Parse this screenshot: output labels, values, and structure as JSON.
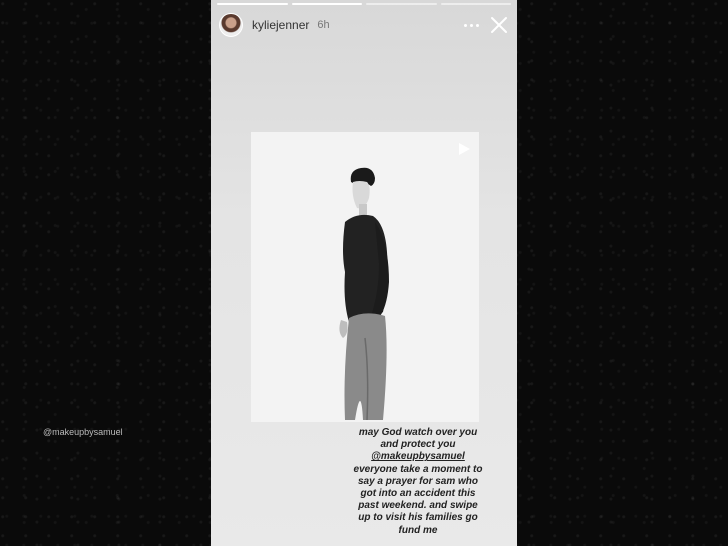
{
  "story": {
    "username": "kyliejenner",
    "time": "6h",
    "progress": {
      "segments": 4,
      "completed": 2
    },
    "watermark": "@makeupbysamuel",
    "caption_lines": [
      "may God watch over you",
      "and protect you",
      "@makeupbysamuel",
      "everyone take a moment to",
      "say a prayer for sam who",
      "got into an accident this",
      "past weekend. and swipe",
      "up to visit his families go",
      "fund me"
    ]
  },
  "icons": {
    "more": "more-horizontal-icon",
    "close": "close-icon",
    "play": "play-icon"
  }
}
